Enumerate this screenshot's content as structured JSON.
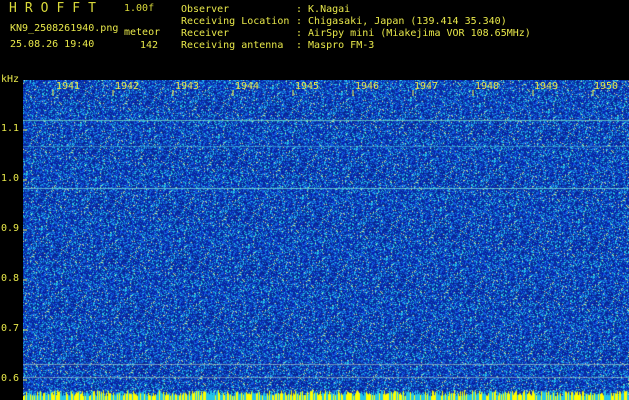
{
  "header": {
    "app_title": "HROFFT",
    "version": "1.00f",
    "filename": "KN9_2508261940.png",
    "mode": "meteor",
    "datetime": "25.08.26 19:40",
    "count": "142"
  },
  "info": [
    {
      "label": "Observer",
      "value": ": K.Nagai"
    },
    {
      "label": "Receiving Location",
      "value": ": Chigasaki, Japan (139.414 35.340)"
    },
    {
      "label": "Receiver",
      "value": ": AirSpy mini (Miakejima VOR 108.65MHz)"
    },
    {
      "label": "Receiving antenna",
      "value": ": Maspro FM-3"
    }
  ],
  "axis": {
    "unit": "kHz",
    "y_labels": [
      "1.1",
      "1.0",
      "0.9",
      "0.8",
      "0.7",
      "0.6"
    ],
    "x_labels": [
      "1941",
      "1942",
      "1943",
      "1944",
      "1945",
      "1946",
      "1947",
      "1948",
      "1949",
      "1950"
    ]
  },
  "colors": {
    "text": "#e8e84a",
    "background": "#000000",
    "waterfall_base": "#0a1a9a",
    "waterfall_hot": "#29e0e8",
    "bottom_strip": "#ffff00"
  }
}
